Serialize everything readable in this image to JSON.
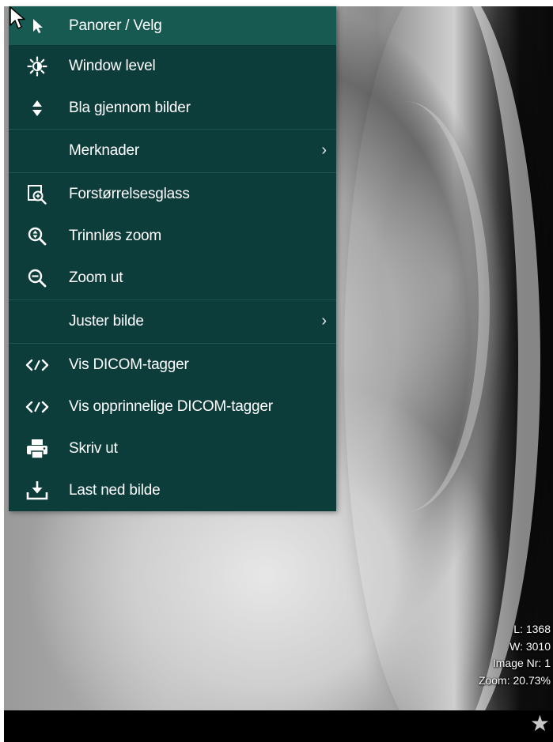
{
  "menu": {
    "items": [
      {
        "label": "Panorer / Velg",
        "icon": "pan-select-icon",
        "active": true
      },
      {
        "label": "Window level",
        "icon": "window-level-icon"
      },
      {
        "label": "Bla gjennom bilder",
        "icon": "scroll-images-icon"
      },
      {
        "label": "Merknader",
        "icon": "",
        "submenu": true
      },
      {
        "label": "Forstørrelsesglass",
        "icon": "magnifier-icon"
      },
      {
        "label": "Trinnløs zoom",
        "icon": "zoom-continuous-icon"
      },
      {
        "label": "Zoom ut",
        "icon": "zoom-out-icon"
      },
      {
        "label": "Juster bilde",
        "icon": "",
        "submenu": true
      },
      {
        "label": "Vis DICOM-tagger",
        "icon": "code-icon"
      },
      {
        "label": "Vis opprinnelige DICOM-tagger",
        "icon": "code-icon"
      },
      {
        "label": "Skriv ut",
        "icon": "print-icon"
      },
      {
        "label": "Last ned bilde",
        "icon": "download-icon"
      }
    ],
    "chevron": "›"
  },
  "overlay": {
    "level": "L: 1368",
    "width": "W: 3010",
    "image_nr": "Image Nr: 1",
    "zoom": "Zoom: 20.73%"
  },
  "star_glyph": "★",
  "colors": {
    "menu_bg": "#0d3d3a",
    "menu_active": "#165a52",
    "text": "#ffffff"
  }
}
